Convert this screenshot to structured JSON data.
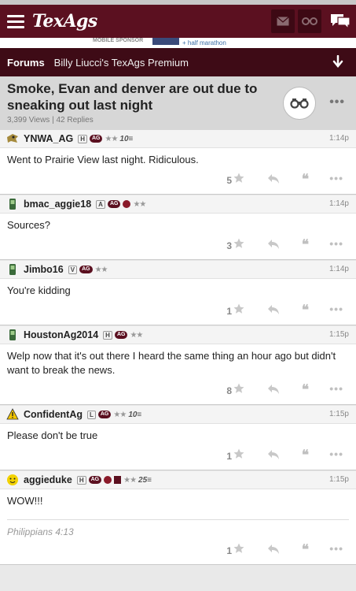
{
  "app": {
    "logo": "TexAgs"
  },
  "sponsor": {
    "left": "MOBILE SPONSOR",
    "right": "+ half marathon"
  },
  "forumbar": {
    "forums_label": "Forums",
    "forum_name": "Billy Liucci's TexAgs Premium"
  },
  "thread": {
    "title": "Smoke, Evan and denver are out due to sneaking out last night",
    "views": "3,399 Views",
    "replies": "42 Replies"
  },
  "posts": [
    {
      "user": "YNWA_AG",
      "level": "H",
      "stars": "★★",
      "year": "10≡",
      "time": "1:14p",
      "body": "Went to Prairie View last night. Ridiculous.",
      "likes": "5"
    },
    {
      "user": "bmac_aggie18",
      "level": "A",
      "stars": "★★",
      "year": "",
      "time": "1:14p",
      "body": "Sources?",
      "likes": "3"
    },
    {
      "user": "Jimbo16",
      "level": "V",
      "stars": "★★",
      "year": "",
      "time": "1:14p",
      "body": "You're kidding",
      "likes": "1"
    },
    {
      "user": "HoustonAg2014",
      "level": "H",
      "stars": "★★",
      "year": "",
      "time": "1:15p",
      "body": "Welp now that it's out there I heard the same thing an hour ago but didn't want to break the news.",
      "likes": "8"
    },
    {
      "user": "ConfidentAg",
      "level": "L",
      "stars": "★★",
      "year": "10≡",
      "time": "1:15p",
      "body": "Please don't be true",
      "likes": "1"
    },
    {
      "user": "aggieduke",
      "level": "H",
      "stars": "★★",
      "year": "25≡",
      "time": "1:15p",
      "body": "WOW!!!",
      "signature": "Philippians 4:13",
      "likes": "1"
    }
  ],
  "badge_ag": "AG",
  "colors": {
    "maroon": "#5b1020",
    "dark_maroon": "#3e0b16"
  },
  "icons": [
    "hamburger-icon",
    "mail-icon",
    "binoculars-icon",
    "chat-icon",
    "arrow-down-icon",
    "star-icon",
    "reply-icon",
    "quote-icon",
    "more-icon"
  ]
}
